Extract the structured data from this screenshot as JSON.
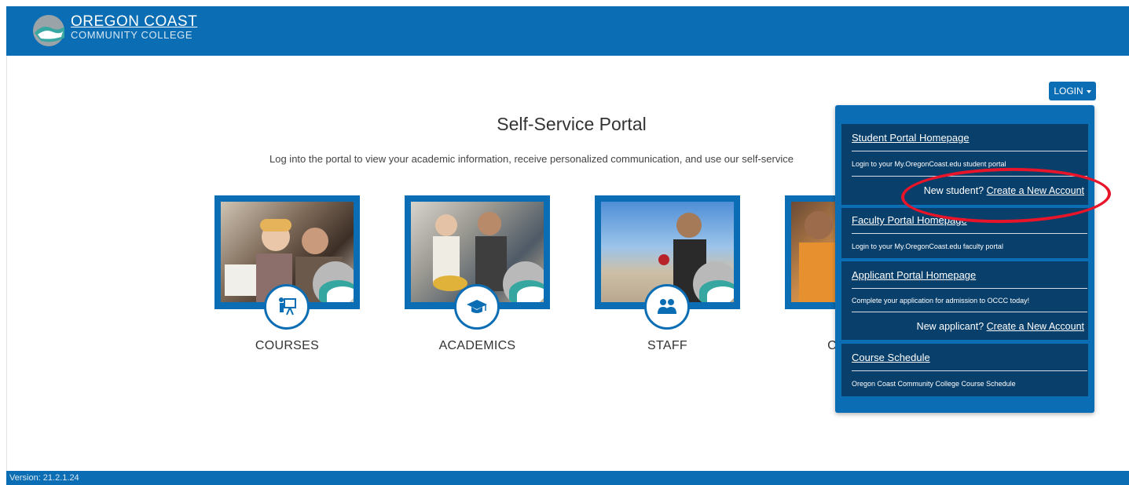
{
  "header": {
    "logo_line1": "OREGON COAST",
    "logo_line2": "COMMUNITY COLLEGE"
  },
  "login": {
    "label": "LOGIN"
  },
  "main": {
    "title": "Self-Service Portal",
    "subtitle": "Log into the portal to view your academic information, receive personalized communication, and use our self-service"
  },
  "tiles": [
    {
      "label": "COURSES",
      "icon": "presentation-icon"
    },
    {
      "label": "ACADEMICS",
      "icon": "graduation-cap-icon"
    },
    {
      "label": "STAFF",
      "icon": "people-icon"
    },
    {
      "label": "C",
      "icon": "unknown-icon"
    }
  ],
  "dropdown": {
    "student": {
      "link": "Student Portal Homepage",
      "desc": "Login to your My.OregonCoast.edu student portal",
      "new_prefix": "New student?",
      "new_link": "Create a New Account"
    },
    "faculty": {
      "link": "Faculty Portal Homepage",
      "desc": "Login to your My.OregonCoast.edu faculty portal"
    },
    "applicant": {
      "link": "Applicant Portal Homepage",
      "desc": "Complete your application for admission to OCCC today!",
      "new_prefix": "New applicant?",
      "new_link": "Create a New Account"
    },
    "schedule": {
      "link": "Course Schedule",
      "desc": "Oregon Coast Community College Course Schedule"
    }
  },
  "footer": {
    "version": "Version: 21.2.1.24"
  },
  "colors": {
    "brand": "#0b6db3",
    "panel": "#093f6b",
    "annotation": "#e8142a"
  }
}
